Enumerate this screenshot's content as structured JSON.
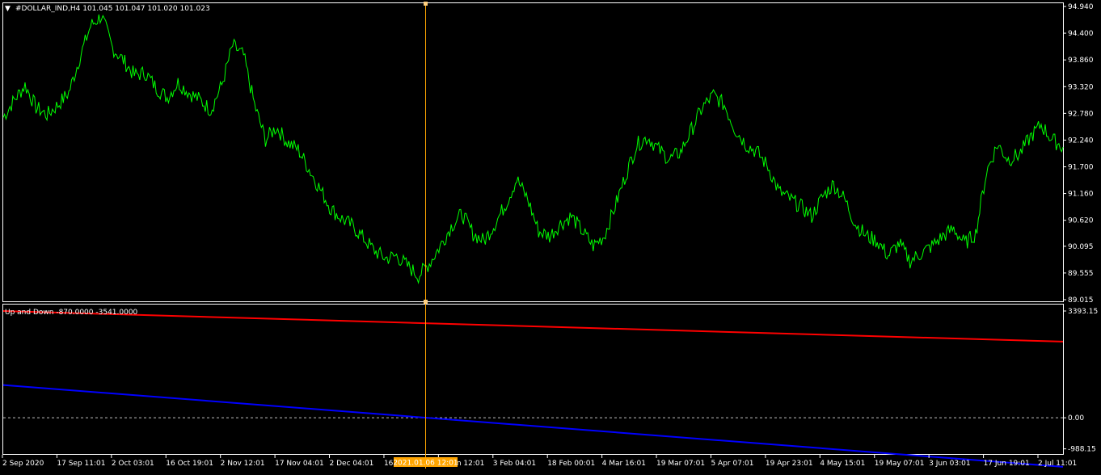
{
  "window": {
    "symbol_header": "#DOLLAR_IND,H4  101.045 101.047 101.020 101.023",
    "indicator_header": "Up and Down -870.0000 -3541.0000"
  },
  "colors": {
    "background": "#000000",
    "frame": "#ffffff",
    "price_line": "#00ff00",
    "up_line": "#ff0000",
    "down_line": "#0000ff",
    "crosshair": "#ffa500",
    "zero_line": "#c0c0c0"
  },
  "crosshair": {
    "time_label": "2021.01.06 12:01"
  },
  "chart_data": [
    {
      "type": "line",
      "title": "#DOLLAR_IND,H4  101.045 101.047 101.020 101.023",
      "ylim": [
        89.015,
        94.94
      ],
      "y_ticks": [
        "94.940",
        "94.400",
        "93.860",
        "93.320",
        "92.780",
        "92.240",
        "91.700",
        "91.160",
        "90.620",
        "90.095",
        "89.555",
        "89.015"
      ],
      "x_ticks": [
        "2 Sep 2020",
        "17 Sep 11:01",
        "2 Oct 03:01",
        "16 Oct 19:01",
        "2 Nov 12:01",
        "17 Nov 04:01",
        "2 Dec 04:01",
        "16 Dec 1",
        "19 Jan 12:01",
        "3 Feb 04:01",
        "18 Feb 00:01",
        "4 Mar 16:01",
        "19 Mar 07:01",
        "5 Apr 07:01",
        "19 Apr 23:01",
        "4 May 15:01",
        "19 May 07:01",
        "3 Jun 03:01",
        "17 Jun 19:01",
        "2 Jul 11:01"
      ],
      "series": [
        {
          "values": [
            92.7,
            93.05,
            93.35,
            92.9,
            92.75,
            92.95,
            93.2,
            93.9,
            94.55,
            94.75,
            94.1,
            93.85,
            93.55,
            93.6,
            93.3,
            93.1,
            93.4,
            93.2,
            93.05,
            92.85,
            93.35,
            94.15,
            93.95,
            92.95,
            92.25,
            92.5,
            92.2,
            92.05,
            91.65,
            91.25,
            90.85,
            90.65,
            90.5,
            90.25,
            90.0,
            89.85,
            89.9,
            89.7,
            89.5,
            89.75,
            90.1,
            90.5,
            90.75,
            90.35,
            90.2,
            90.55,
            90.95,
            91.45,
            91.05,
            90.4,
            90.3,
            90.55,
            90.7,
            90.4,
            90.1,
            90.3,
            90.9,
            91.55,
            92.15,
            92.3,
            92.05,
            91.85,
            92.0,
            92.45,
            92.9,
            93.15,
            92.95,
            92.45,
            92.15,
            92.0,
            91.7,
            91.2,
            91.05,
            90.9,
            90.7,
            91.1,
            91.35,
            91.05,
            90.55,
            90.3,
            90.2,
            89.9,
            90.15,
            89.8,
            89.95,
            90.1,
            90.3,
            90.45,
            90.15,
            90.35,
            91.6,
            92.15,
            91.85,
            91.95,
            92.3,
            92.55,
            92.25,
            92.1
          ]
        }
      ]
    },
    {
      "type": "line",
      "title": "Up and Down -870.0000 -3541.0000",
      "ylim": [
        -1100,
        3393.15
      ],
      "y_ticks": [
        "3393.15",
        "0.00",
        "-988.15"
      ],
      "series": [
        {
          "values": [
            3393.15,
            2420
          ]
        },
        {
          "values": [
            1040,
            -1560
          ]
        }
      ]
    }
  ]
}
